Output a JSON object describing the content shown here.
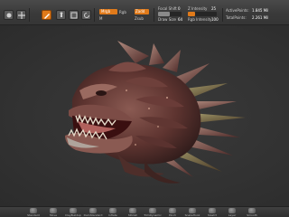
{
  "colors": {
    "accent": "#e07a1a",
    "background": "#333333"
  },
  "toolbar": {
    "icons": [
      {
        "name": "sculptris-icon"
      },
      {
        "name": "gizmo-move-icon"
      },
      {
        "name": "edit-icon"
      },
      {
        "name": "move-icon"
      },
      {
        "name": "scale-icon"
      },
      {
        "name": "rotate-icon"
      }
    ],
    "draw_mode": {
      "label": "Draw"
    },
    "mrgb": {
      "label": "Mrgb",
      "rgb": "Rgb",
      "m": "M"
    },
    "zadd": {
      "label": "Zadd",
      "value": "25"
    },
    "zsub": {
      "label": "Zsub"
    },
    "focal": {
      "label": "Focal Shift",
      "value": "0"
    },
    "draw_size": {
      "label": "Draw Size",
      "value": "64"
    },
    "z_intensity": {
      "label": "Z Intensity",
      "value": "25",
      "level": 0.25
    },
    "rgb_intensity": {
      "label": "Rgb Intensity",
      "value": "100",
      "level": 1.0
    },
    "active_points": {
      "label": "ActivePoints:",
      "value": "1.845 Mil"
    },
    "total_points": {
      "label": "TotalPoints:",
      "value": "2.261 Mil"
    }
  },
  "viewport": {
    "model": "dragon-head-sculpt"
  },
  "shelf": {
    "items": [
      {
        "label": "Standard"
      },
      {
        "label": "Move"
      },
      {
        "label": "ClayBuildup"
      },
      {
        "label": "DamStandard"
      },
      {
        "label": "Inflate"
      },
      {
        "label": "hPolish"
      },
      {
        "label": "TrimDynamic"
      },
      {
        "label": "Pinch"
      },
      {
        "label": "SnakeHook"
      },
      {
        "label": "Slash3"
      },
      {
        "label": "Layer"
      },
      {
        "label": "Smooth"
      }
    ]
  }
}
